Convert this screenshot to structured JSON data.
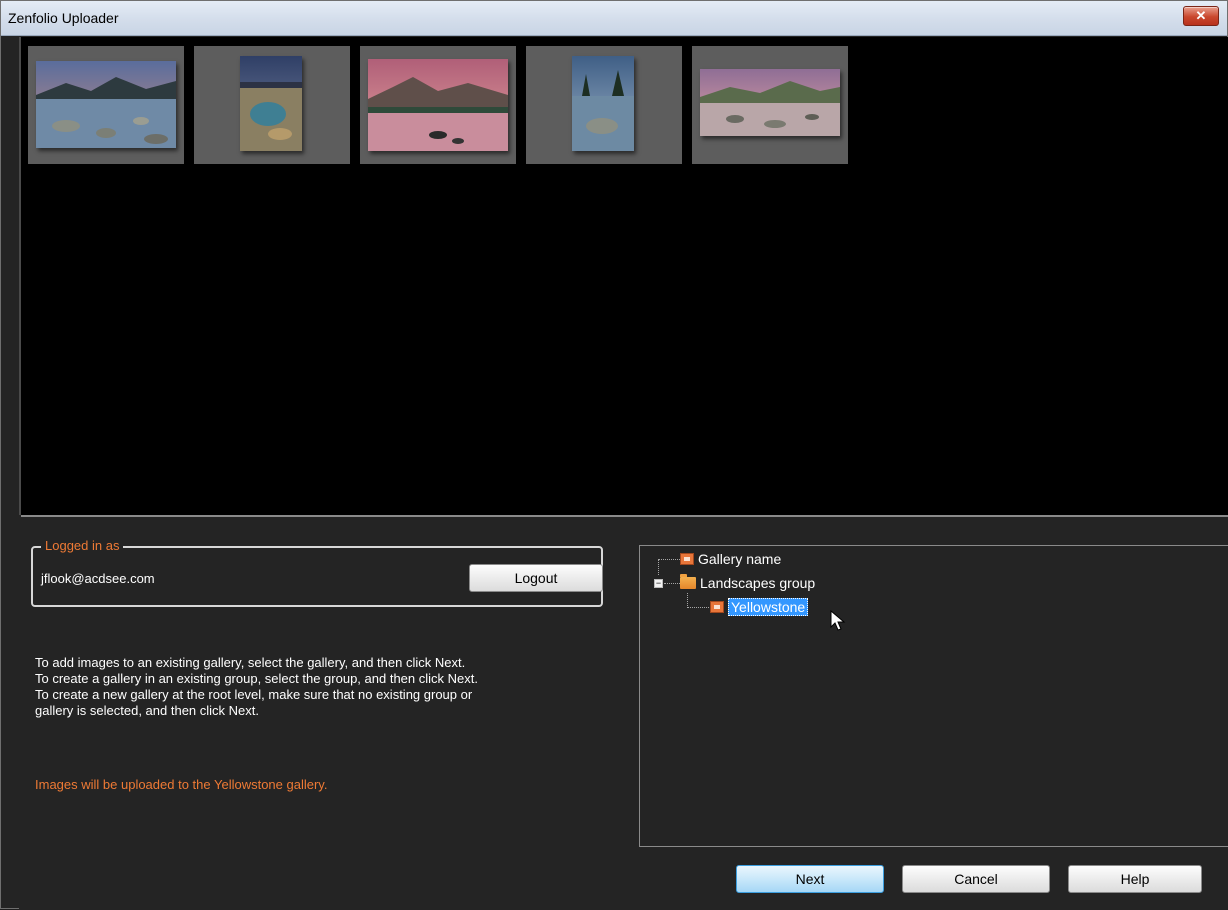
{
  "window": {
    "title": "Zenfolio Uploader",
    "close_icon": "close-icon"
  },
  "thumbnails": [
    {
      "name": "lake-rocks-landscape-1",
      "orientation": "landscape"
    },
    {
      "name": "rock-shore-portrait",
      "orientation": "portrait"
    },
    {
      "name": "mountain-lake-reflection",
      "orientation": "landscape"
    },
    {
      "name": "pine-lake-portrait",
      "orientation": "portrait"
    },
    {
      "name": "rocky-lake-panorama",
      "orientation": "landscape"
    }
  ],
  "account": {
    "group_label": "Logged in as",
    "user": "jflook@acdsee.com",
    "logout_label": "Logout"
  },
  "instructions": [
    "To add images to an existing gallery, select the gallery, and then click Next.",
    "To create a gallery in an existing group, select the group, and then click Next.",
    "To create a new gallery at the root level, make sure that no existing group or",
    "gallery is selected, and then click Next."
  ],
  "status": "Images will be uploaded to the Yellowstone gallery.",
  "tree": {
    "items": [
      {
        "label": "Gallery name",
        "type": "gallery",
        "icon": "gallery-icon"
      },
      {
        "label": "Landscapes group",
        "type": "group",
        "icon": "folder-icon",
        "expanded": true
      },
      {
        "label": "Yellowstone",
        "type": "gallery",
        "icon": "gallery-icon",
        "selected": true
      }
    ]
  },
  "buttons": {
    "next": "Next",
    "cancel": "Cancel",
    "help": "Help"
  },
  "colors": {
    "accent_orange": "#ee7a35",
    "selection_blue": "#3397ff",
    "background": "#242424"
  }
}
